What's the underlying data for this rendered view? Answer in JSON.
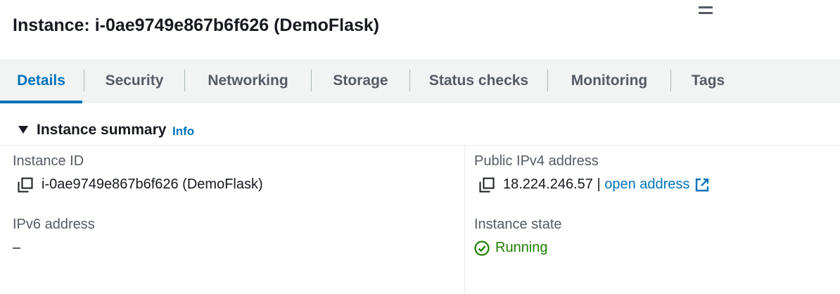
{
  "header": {
    "title": "Instance: i-0ae9749e867b6f626 (DemoFlask)",
    "menu_icon": "hamburger-menu-icon"
  },
  "tabs": [
    {
      "label": "Details",
      "active": true
    },
    {
      "label": "Security",
      "active": false
    },
    {
      "label": "Networking",
      "active": false
    },
    {
      "label": "Storage",
      "active": false
    },
    {
      "label": "Status checks",
      "active": false
    },
    {
      "label": "Monitoring",
      "active": false
    },
    {
      "label": "Tags",
      "active": false
    }
  ],
  "summary": {
    "title": "Instance summary",
    "info_label": "Info",
    "expanded": true
  },
  "fields": {
    "instance_id": {
      "label": "Instance ID",
      "value": "i-0ae9749e867b6f626 (DemoFlask)",
      "icon": "copy-icon"
    },
    "public_ipv4": {
      "label": "Public IPv4 address",
      "value": "18.224.246.57",
      "separator": " | ",
      "link_text": "open address",
      "icon": "copy-icon",
      "link_icon": "external-link-icon"
    },
    "ipv6": {
      "label": "IPv6 address",
      "value": "–"
    },
    "instance_state": {
      "label": "Instance state",
      "value": "Running",
      "icon": "check-circle-icon"
    }
  },
  "colors": {
    "accent": "#0073bb",
    "success": "#1d8102",
    "text": "#16191f",
    "label": "#545b64",
    "tab_bar_bg": "#f2f3f3"
  }
}
